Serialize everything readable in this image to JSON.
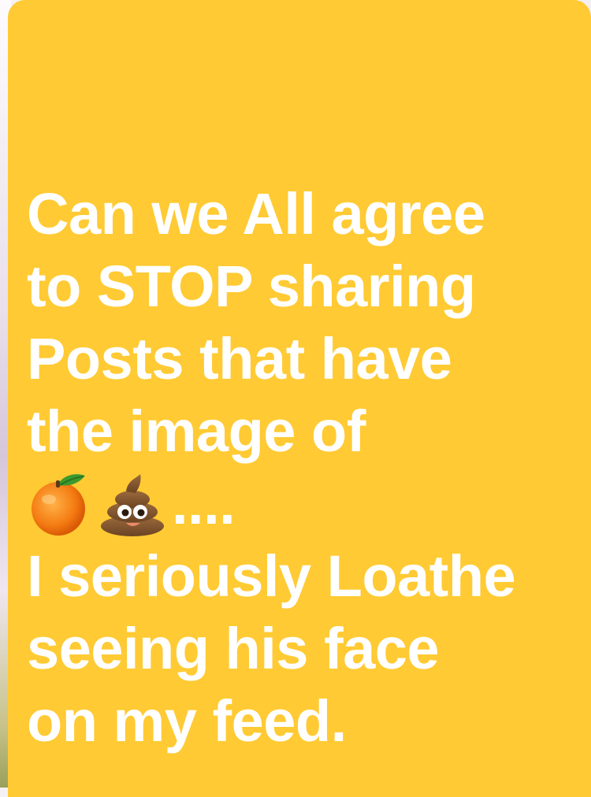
{
  "post": {
    "background_color": "#ffca33",
    "text_color": "#ffffff",
    "lines": [
      "Can we All agree",
      "to STOP sharing",
      "Posts that have",
      "the image of"
    ],
    "emoji_line": {
      "emojis": [
        "tangerine-emoji",
        "pile-of-poo-emoji"
      ],
      "suffix": "...."
    },
    "lines_after": [
      "I seriously Loathe",
      "seeing his face",
      "on my feed."
    ]
  }
}
